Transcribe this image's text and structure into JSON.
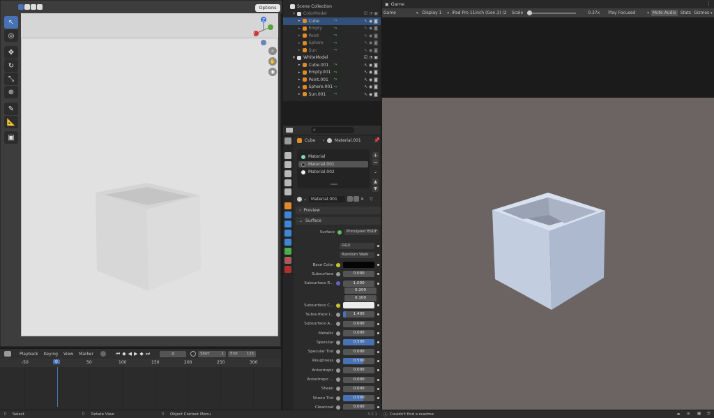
{
  "viewport": {
    "options_label": "Options"
  },
  "timeline": {
    "menu": [
      "Playback",
      "Keying",
      "View",
      "Marker"
    ],
    "current_frame": "0",
    "start_label": "Start",
    "start_value": "1",
    "end_label": "End",
    "end_value": "125",
    "ruler": [
      "-50",
      "0",
      "50",
      "100",
      "150",
      "200",
      "250",
      "300"
    ]
  },
  "statusbar": {
    "select": "Select",
    "rotate": "Rotate View",
    "context": "Object Context Menu",
    "version": "3.2.1",
    "message": "Couldn't find a readme"
  },
  "outliner": {
    "root": "Scene Collection",
    "collections": [
      {
        "name": "ColorModel",
        "items": [
          "Cube",
          "Empty",
          "Point",
          "Sphere",
          "Sun"
        ]
      },
      {
        "name": "WhiteModel",
        "items": [
          "Cube.001",
          "Empty.001",
          "Point.001",
          "Sphere.001",
          "Sun.001"
        ]
      }
    ]
  },
  "properties": {
    "breadcrumb_object": "Cube",
    "breadcrumb_material": "Material.001",
    "materials": [
      "Material",
      "Material.001",
      "Material.002"
    ],
    "active_material": "Material.001",
    "preview_label": "Preview",
    "surface_section": "Surface",
    "surface_label": "Surface",
    "surface_shader": "Principled BSDF",
    "distribution": "GGX",
    "subsurface_method": "Random Walk",
    "rows": [
      {
        "label": "Base Color",
        "value": ""
      },
      {
        "label": "Subsurface",
        "value": "0.000"
      },
      {
        "label": "Subsurface R...",
        "value": "1.000"
      },
      {
        "label": "",
        "value": "0.200"
      },
      {
        "label": "",
        "value": "0.100"
      },
      {
        "label": "Subsurface C...",
        "value": ""
      },
      {
        "label": "Subsurface I...",
        "value": "1.400"
      },
      {
        "label": "Subsurface A...",
        "value": "0.000"
      },
      {
        "label": "Metallic",
        "value": "0.000"
      },
      {
        "label": "Specular",
        "value": "0.500"
      },
      {
        "label": "Specular Tint",
        "value": "0.000"
      },
      {
        "label": "Roughness",
        "value": "0.500"
      },
      {
        "label": "Anisotropic",
        "value": "0.000"
      },
      {
        "label": "Anisotropic ...",
        "value": "0.000"
      },
      {
        "label": "Sheen",
        "value": "0.000"
      },
      {
        "label": "Sheen Tint",
        "value": "0.500"
      },
      {
        "label": "Clearcoat",
        "value": "0.000"
      }
    ]
  },
  "game": {
    "tab": "Game",
    "mode": "Game",
    "display": "Display 1",
    "device": "iPad Pro 11inch (Gen.3) (2",
    "scale_label": "Scale",
    "scale_value": "0.37x",
    "play_focused": "Play Focused",
    "mute_audio": "Mute Audio",
    "stats": "Stats",
    "gizmos": "Gizmos"
  },
  "colors": {
    "accent": "#4772b3",
    "selected_row": "#33507a",
    "floor": "#6c6462",
    "cube": "#c7d1e3"
  }
}
